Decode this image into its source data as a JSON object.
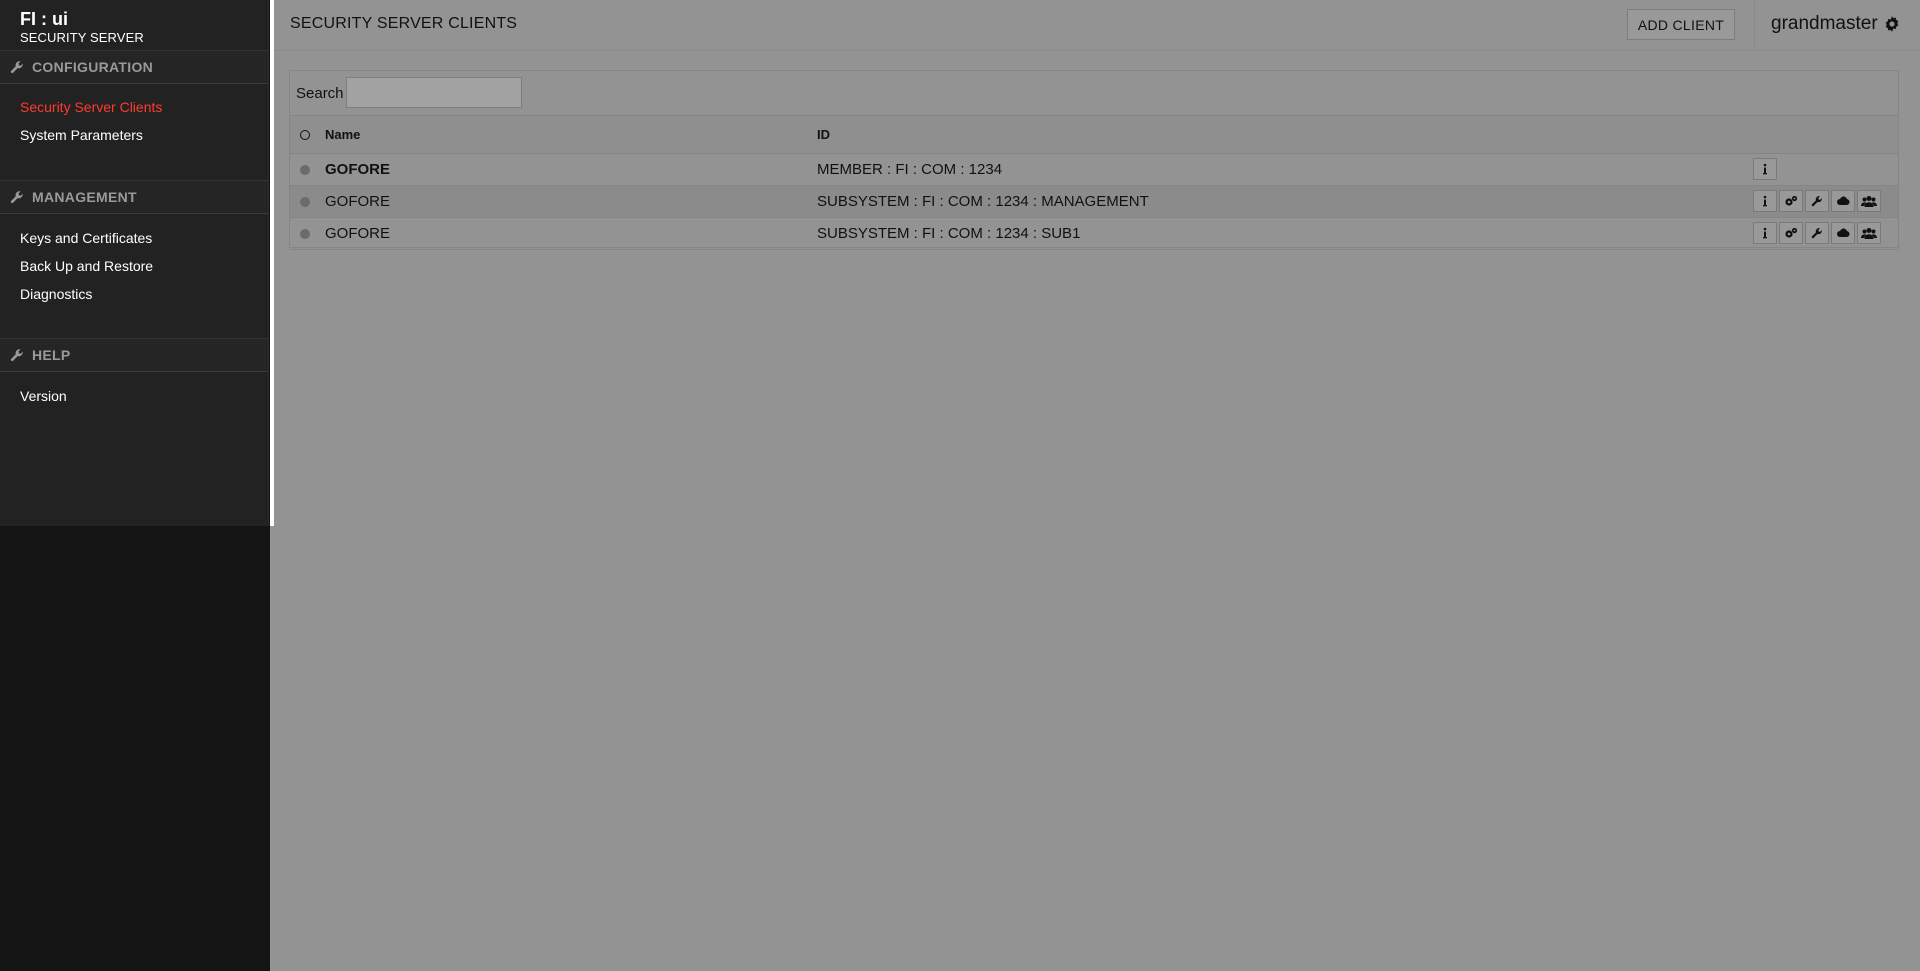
{
  "brand": {
    "title": "FI : ui",
    "subtitle": "SECURITY SERVER"
  },
  "sidebar": {
    "sections": [
      {
        "label": "CONFIGURATION",
        "items": [
          "Security Server Clients",
          "System Parameters"
        ]
      },
      {
        "label": "MANAGEMENT",
        "items": [
          "Keys and Certificates",
          "Back Up and Restore",
          "Diagnostics"
        ]
      },
      {
        "label": "HELP",
        "items": [
          "Version"
        ]
      }
    ],
    "active_item": "Security Server Clients"
  },
  "header": {
    "title": "SECURITY SERVER CLIENTS",
    "add_client_label": "ADD CLIENT",
    "username": "grandmaster"
  },
  "search": {
    "label": "Search",
    "value": ""
  },
  "table": {
    "columns": [
      "Name",
      "ID"
    ],
    "rows": [
      {
        "name": "GOFORE",
        "id": "MEMBER : FI : COM : 1234",
        "bold": true,
        "actions": [
          "info-icon"
        ]
      },
      {
        "name": "GOFORE",
        "id": "SUBSYSTEM : FI : COM : 1234 : MANAGEMENT",
        "bold": false,
        "actions": [
          "info-icon",
          "gears-icon",
          "wrench-icon",
          "cloud-icon",
          "users-icon"
        ]
      },
      {
        "name": "GOFORE",
        "id": "SUBSYSTEM : FI : COM : 1234 : SUB1",
        "bold": false,
        "actions": [
          "info-icon",
          "gears-icon",
          "wrench-icon",
          "cloud-icon",
          "users-icon"
        ]
      }
    ]
  },
  "colors": {
    "accent": "#ff3b30",
    "sidebar": "#222222",
    "background": "#939393"
  }
}
